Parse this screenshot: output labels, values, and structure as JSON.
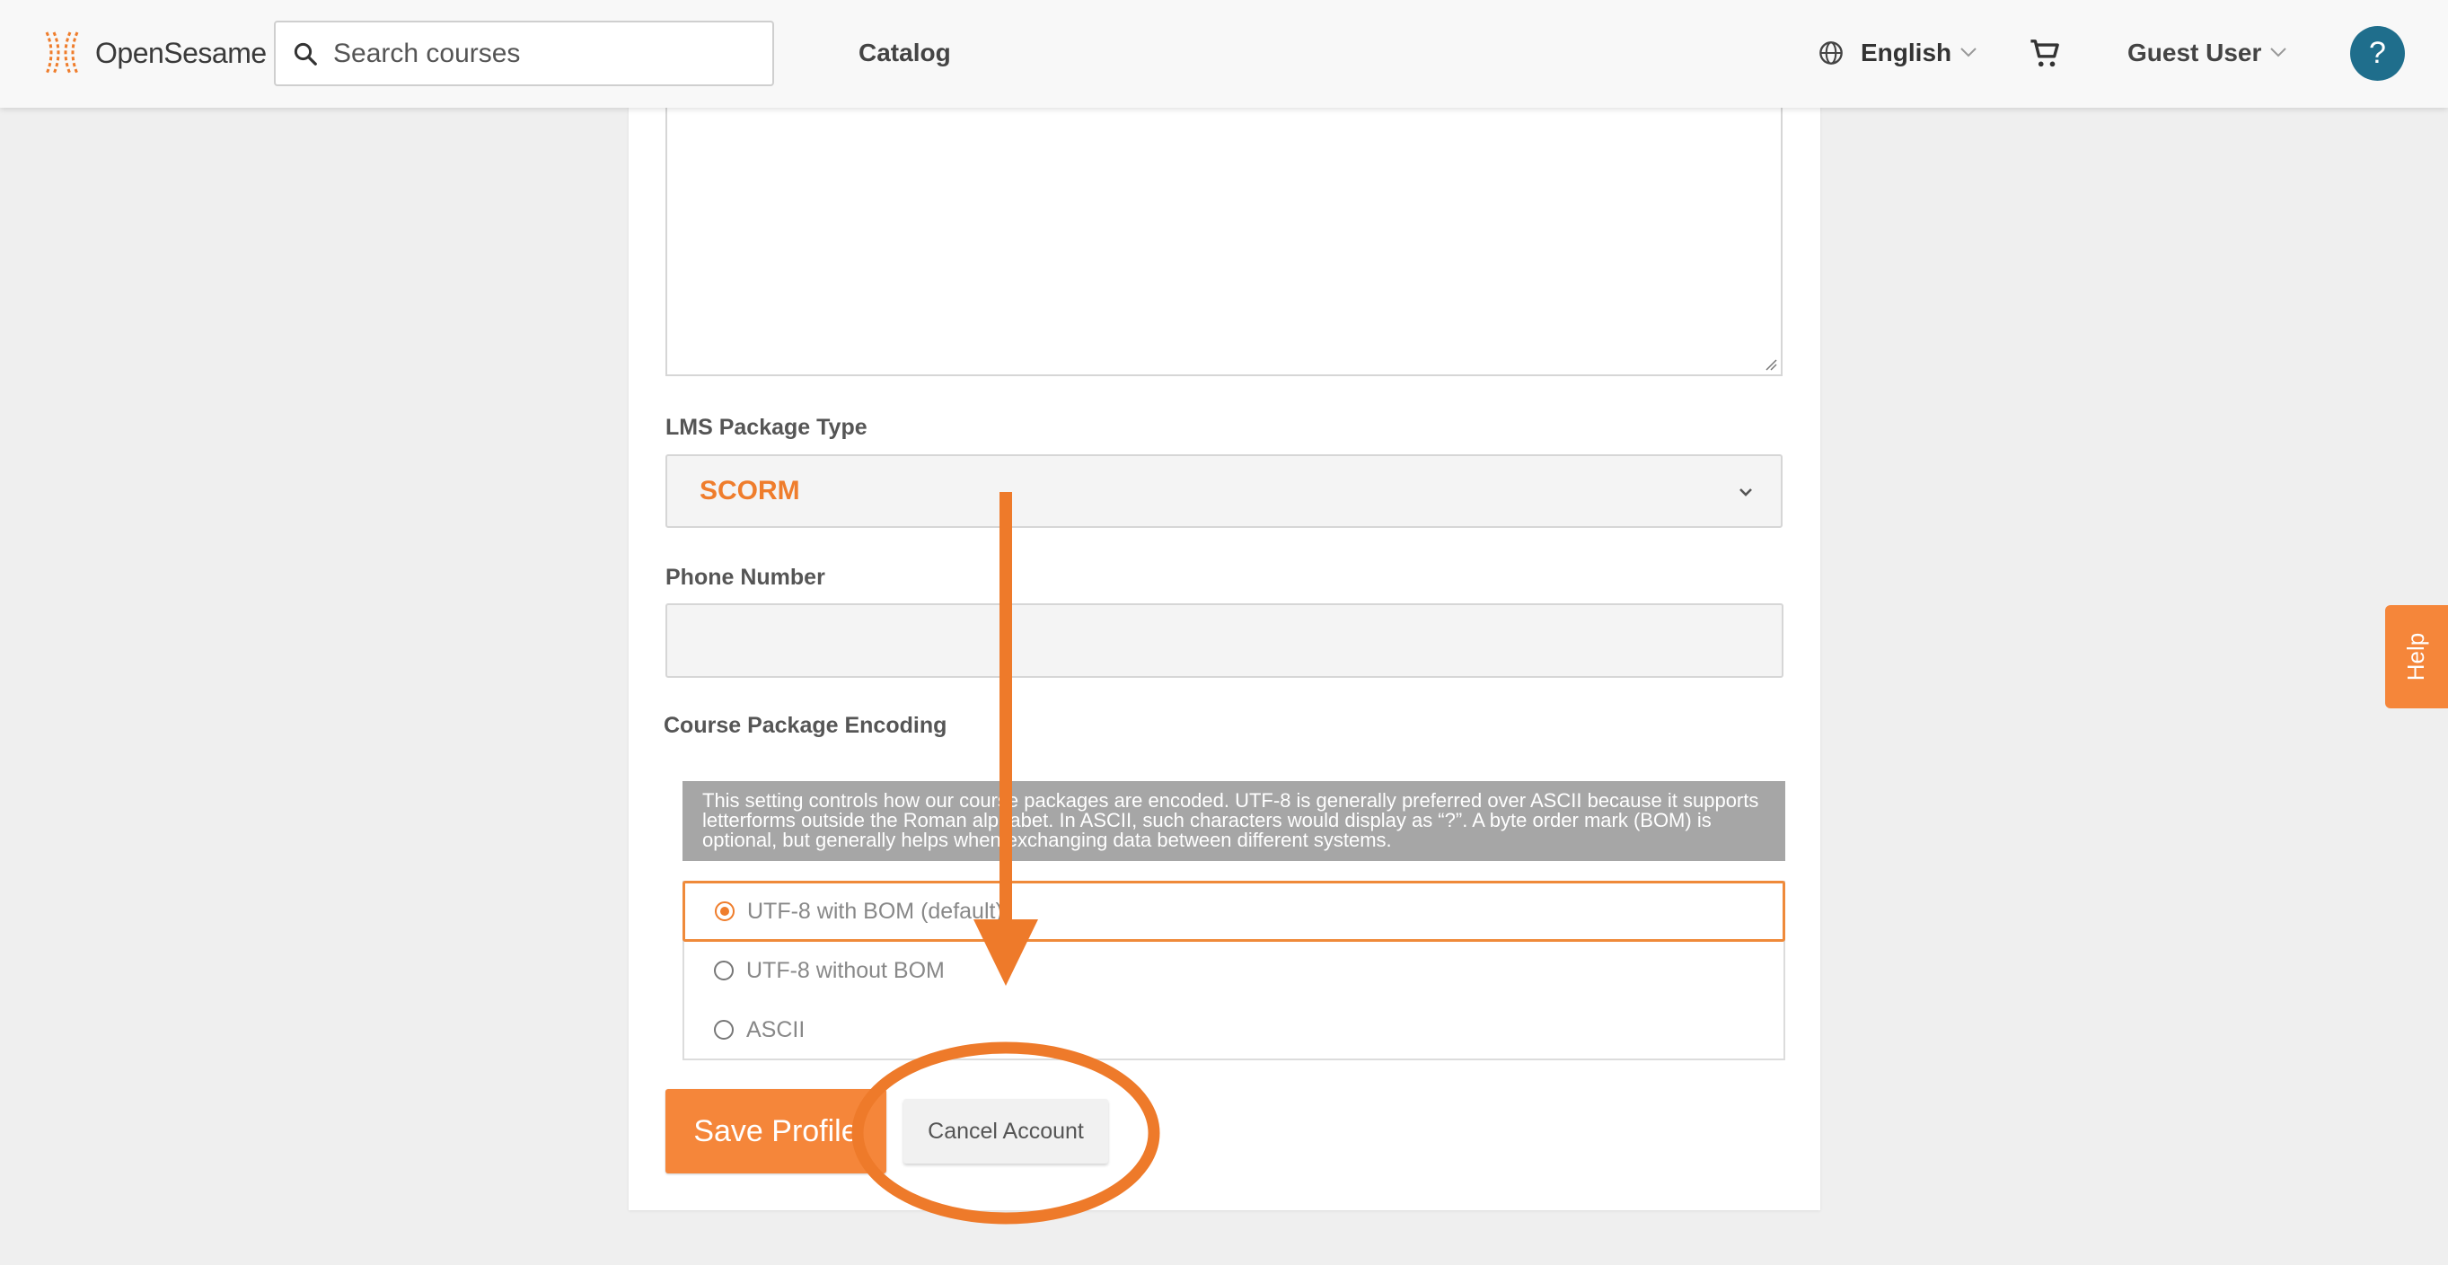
{
  "header": {
    "brand": "OpenSesame",
    "search_placeholder": "Search courses",
    "nav_catalog": "Catalog",
    "language": "English",
    "user": "Guest User",
    "help_symbol": "?"
  },
  "form": {
    "lms_label": "LMS Package Type",
    "lms_value": "SCORM",
    "phone_label": "Phone Number",
    "phone_value": "",
    "encoding_label": "Course Package Encoding",
    "encoding_note": "This setting controls how our course packages are encoded. UTF-8 is generally preferred over ASCII because it supports letterforms outside the Roman alphabet. In ASCII, such characters would display as “?”. A byte order mark (BOM) is optional, but generally helps when exchanging data between different systems.",
    "encoding_options": [
      {
        "label": "UTF-8 with BOM (default)",
        "selected": true
      },
      {
        "label": "UTF-8 without BOM",
        "selected": false
      },
      {
        "label": "ASCII",
        "selected": false
      }
    ],
    "save_label": "Save Profile",
    "cancel_label": "Cancel Account"
  },
  "help_tab": "Help",
  "icons": {
    "search": "search-icon",
    "globe": "globe-icon",
    "cart": "cart-icon",
    "chevron": "chevron-down-icon"
  },
  "colors": {
    "accent": "#f5863a",
    "brand_orange": "#ef7d2c",
    "help_blue": "#1f6e8c",
    "annotation": "#ee7a2a"
  }
}
